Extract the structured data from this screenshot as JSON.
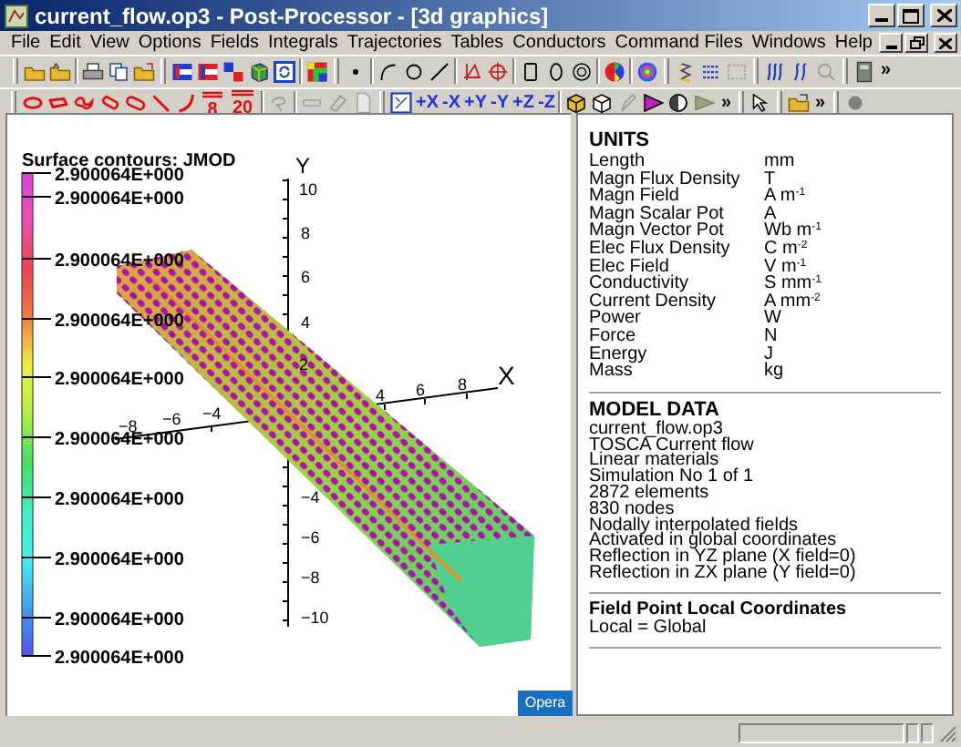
{
  "window": {
    "title": "current_flow.op3 - Post-Processor - [3d graphics]"
  },
  "menu": [
    "File",
    "Edit",
    "View",
    "Options",
    "Fields",
    "Integrals",
    "Trajectories",
    "Tables",
    "Conductors",
    "Command Files",
    "Windows",
    "Help"
  ],
  "toolbar": {
    "axis_buttons": [
      "+X",
      "-X",
      "+Y",
      "-Y",
      "+Z",
      "-Z"
    ],
    "icon_digits": [
      "8",
      "20"
    ],
    "chevrons": [
      "»",
      "»",
      "»"
    ]
  },
  "plot": {
    "title": "Surface contours: JMOD",
    "legend": [
      "2.900064E+000",
      "2.900064E+000",
      "2.900064E+000",
      "2.900064E+000",
      "2.900064E+000",
      "2.900064E+000",
      "2.900064E+000",
      "2.900064E+000",
      "2.900064E+000",
      "2.900064E+000"
    ],
    "y_axis": "Y",
    "x_axis": "X",
    "y_ticks": [
      "10",
      "8",
      "6",
      "4",
      "2",
      "−4",
      "−6",
      "−8",
      "−10"
    ],
    "x_ticks": [
      "−8",
      "−6",
      "−4",
      "4",
      "6",
      "8"
    ],
    "badge": "Opera"
  },
  "info": {
    "units_heading": "UNITS",
    "units": [
      {
        "name": "Length",
        "value": "mm"
      },
      {
        "name": "Magn Flux Density",
        "value": "T"
      },
      {
        "name": "Magn Field",
        "value": "A m$^{-1}$"
      },
      {
        "name": "Magn Scalar Pot",
        "value": "A"
      },
      {
        "name": "Magn Vector Pot",
        "value": "Wb m$^{-1}$"
      },
      {
        "name": "Elec Flux Density",
        "value": "C m$^{-2}$"
      },
      {
        "name": "Elec Field",
        "value": "V m$^{-1}$"
      },
      {
        "name": "Conductivity",
        "value": "S mm$^{-1}$"
      },
      {
        "name": "Current Density",
        "value": "A mm$^{-2}$"
      },
      {
        "name": "Power",
        "value": "W"
      },
      {
        "name": "Force",
        "value": "N"
      },
      {
        "name": "Energy",
        "value": "J"
      },
      {
        "name": "Mass",
        "value": "kg"
      }
    ],
    "model_heading": "MODEL DATA",
    "model_lines": [
      "current_flow.op3",
      "TOSCA Current flow",
      "Linear materials",
      "Simulation No 1 of 1",
      "2872 elements",
      "830 nodes",
      "Nodally interpolated fields",
      "Activated in global coordinates",
      "Reflection in YZ plane (X field=0)",
      "Reflection in ZX plane (Y field=0)"
    ],
    "local_heading": "Field Point Local Coordinates",
    "local_lines": [
      "Local = Global"
    ]
  }
}
